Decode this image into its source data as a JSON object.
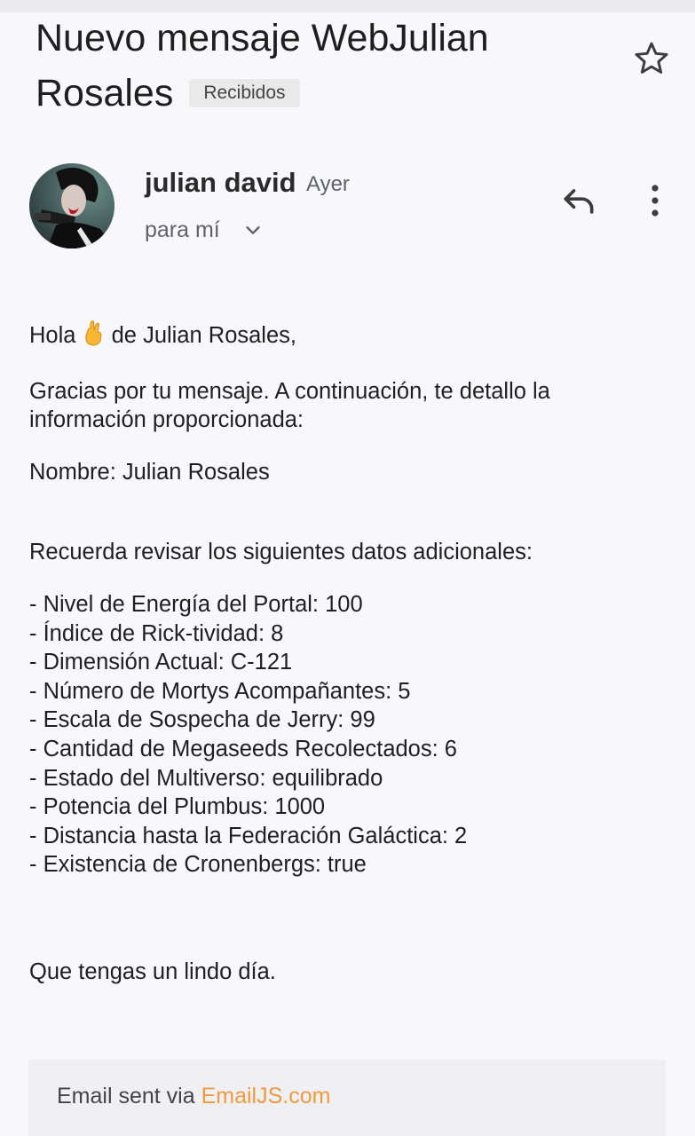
{
  "email": {
    "subject": "Nuevo mensaje WebJulian Rosales",
    "label": "Recibidos",
    "sender": "julian david",
    "time": "Ayer",
    "recipient": "para mí",
    "greeting_before": "Hola ",
    "greeting_after": " de Julian Rosales,",
    "intro": "Gracias por tu mensaje. A continuación, te detallo la información proporcionada:",
    "name_line": "Nombre: Julian Rosales",
    "reminder": "Recuerda revisar los siguientes datos adicionales:",
    "details": [
      "- Nivel de Energía del Portal: 100",
      "- Índice de Rick-tividad: 8",
      "- Dimensión Actual: C-121",
      "- Número de Mortys Acompañantes: 5",
      "- Escala de Sospecha de Jerry: 99",
      "- Cantidad de Megaseeds Recolectados: 6",
      "- Estado del Multiverso: equilibrado",
      "- Potencia del Plumbus: 1000",
      "- Distancia hasta la Federación Galáctica: 2",
      "- Existencia de Cronenbergs: true"
    ],
    "closing": "Que tengas un lindo día.",
    "footer_prefix": "Email sent via ",
    "footer_link": "EmailJS.com"
  },
  "icons": {
    "star": "star-outline-icon",
    "reply": "reply-icon",
    "more": "more-vertical-icon",
    "chevron": "chevron-down-icon",
    "emoji": "crossed-fingers-emoji"
  },
  "colors": {
    "background": "#f8f7fc",
    "link": "#ef9a3c",
    "footer_bg": "#f0eff4",
    "badge_bg": "#e9e9e9"
  }
}
